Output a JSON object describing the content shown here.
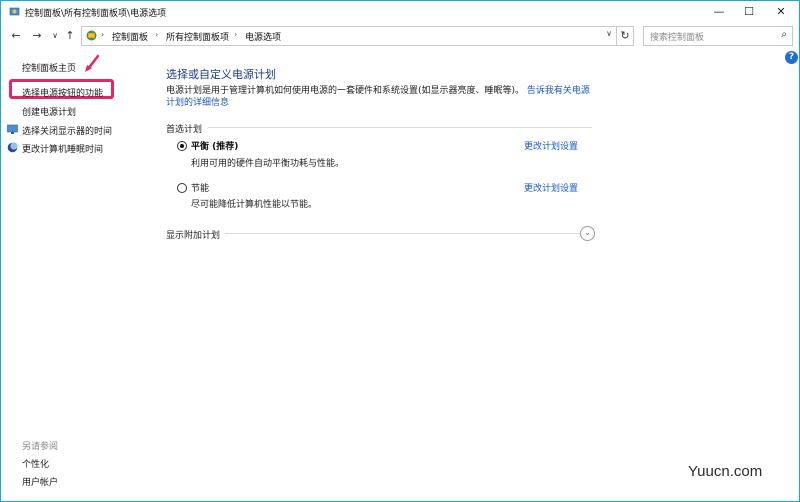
{
  "window": {
    "title": "控制面板\\所有控制面板项\\电源选项",
    "minimize_glyph": "—",
    "maximize_glyph": "☐",
    "close_glyph": "✕"
  },
  "nav": {
    "back_glyph": "←",
    "forward_glyph": "→",
    "dropdown_glyph": "∨",
    "up_glyph": "↑",
    "breadcrumbs": [
      "控制面板",
      "所有控制面板项",
      "电源选项"
    ],
    "crumb_separator": "›",
    "address_dropdown_glyph": "∨",
    "refresh_glyph": "↻",
    "search_placeholder": "搜索控制面板",
    "search_glyph": "⌕",
    "help_glyph": "?"
  },
  "sidebar": {
    "items": [
      {
        "label": "控制面板主页",
        "icon": null
      },
      {
        "label": "选择电源按钮的功能",
        "icon": null,
        "highlighted": true
      },
      {
        "label": "创建电源计划",
        "icon": null
      },
      {
        "label": "选择关闭显示器的时间",
        "icon": "monitor-icon"
      },
      {
        "label": "更改计算机睡眠时间",
        "icon": "moon-icon"
      }
    ],
    "see_also_title": "另请参阅",
    "see_also": [
      "个性化",
      "用户帐户"
    ]
  },
  "main": {
    "heading": "选择或自定义电源计划",
    "description": "电源计划是用于管理计算机如何使用电源的一套硬件和系统设置(如显示器亮度、睡眠等)。",
    "description_link": "告诉我有关电源计划的详细信息",
    "group_title": "首选计划",
    "plans": [
      {
        "name": "平衡 (推荐)",
        "description": "利用可用的硬件自动平衡功耗与性能。",
        "link": "更改计划设置",
        "selected": true
      },
      {
        "name": "节能",
        "description": "尽可能降低计算机性能以节能。",
        "link": "更改计划设置",
        "selected": false
      }
    ],
    "more_plans": "显示附加计划",
    "expand_glyph": "⌄"
  },
  "colors": {
    "highlight_border": "#e6246a",
    "link": "#1a56c9",
    "heading": "#1e3a8a",
    "window_border": "#17a9d8"
  },
  "watermark": "Yuucn.com"
}
